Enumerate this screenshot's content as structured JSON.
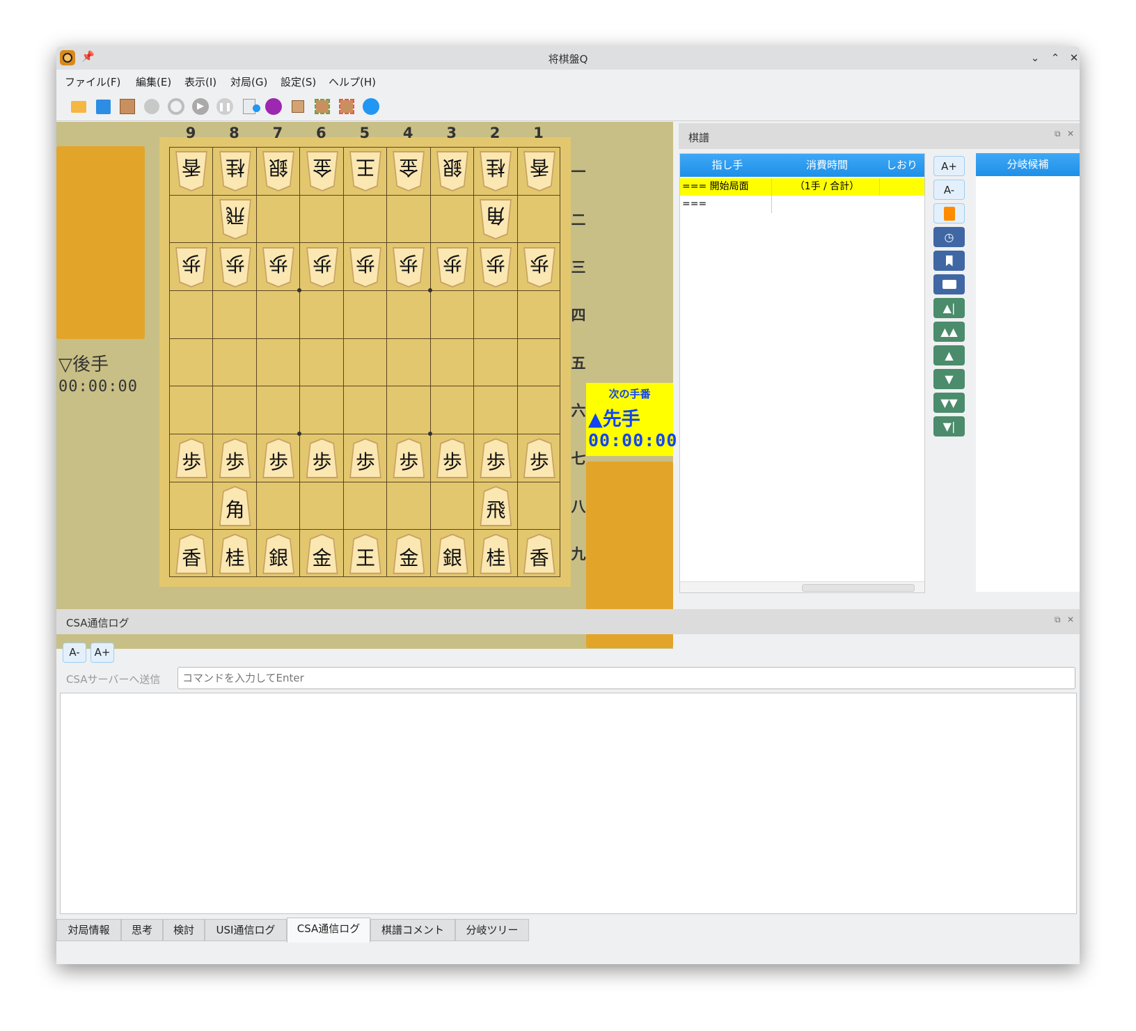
{
  "window": {
    "title": "将棋盤Q"
  },
  "menu": [
    "ファイル(F)",
    "編集(E)",
    "表示(I)",
    "対局(G)",
    "設定(S)",
    "ヘルプ(H)"
  ],
  "toolbar_icons": [
    "open-file-icon",
    "save-icon",
    "board-icon",
    "resign-icon",
    "stop-icon",
    "play-icon",
    "pause-icon",
    "kifu-time-icon",
    "engine-icon",
    "resize-board-icon",
    "enlarge-board-icon",
    "shrink-board-icon",
    "flip-board-icon"
  ],
  "board": {
    "files": [
      "9",
      "8",
      "7",
      "6",
      "5",
      "4",
      "3",
      "2",
      "1"
    ],
    "ranks": [
      "一",
      "二",
      "三",
      "四",
      "五",
      "六",
      "七",
      "八",
      "九"
    ],
    "rows": [
      [
        [
          "香",
          "g"
        ],
        [
          "桂",
          "g"
        ],
        [
          "銀",
          "g"
        ],
        [
          "金",
          "g"
        ],
        [
          "王",
          "g"
        ],
        [
          "金",
          "g"
        ],
        [
          "銀",
          "g"
        ],
        [
          "桂",
          "g"
        ],
        [
          "香",
          "g"
        ]
      ],
      [
        null,
        [
          "飛",
          "g"
        ],
        null,
        null,
        null,
        null,
        null,
        [
          "角",
          "g"
        ],
        null
      ],
      [
        [
          "歩",
          "g"
        ],
        [
          "歩",
          "g"
        ],
        [
          "歩",
          "g"
        ],
        [
          "歩",
          "g"
        ],
        [
          "歩",
          "g"
        ],
        [
          "歩",
          "g"
        ],
        [
          "歩",
          "g"
        ],
        [
          "歩",
          "g"
        ],
        [
          "歩",
          "g"
        ]
      ],
      [
        null,
        null,
        null,
        null,
        null,
        null,
        null,
        null,
        null
      ],
      [
        null,
        null,
        null,
        null,
        null,
        null,
        null,
        null,
        null
      ],
      [
        null,
        null,
        null,
        null,
        null,
        null,
        null,
        null,
        null
      ],
      [
        [
          "歩",
          "s"
        ],
        [
          "歩",
          "s"
        ],
        [
          "歩",
          "s"
        ],
        [
          "歩",
          "s"
        ],
        [
          "歩",
          "s"
        ],
        [
          "歩",
          "s"
        ],
        [
          "歩",
          "s"
        ],
        [
          "歩",
          "s"
        ],
        [
          "歩",
          "s"
        ]
      ],
      [
        null,
        [
          "角",
          "s"
        ],
        null,
        null,
        null,
        null,
        null,
        [
          "飛",
          "s"
        ],
        null
      ],
      [
        [
          "香",
          "s"
        ],
        [
          "桂",
          "s"
        ],
        [
          "銀",
          "s"
        ],
        [
          "金",
          "s"
        ],
        [
          "王",
          "s"
        ],
        [
          "金",
          "s"
        ],
        [
          "銀",
          "s"
        ],
        [
          "桂",
          "s"
        ],
        [
          "香",
          "s"
        ]
      ]
    ]
  },
  "gote": {
    "label": "▽後手",
    "time": "00:00:00"
  },
  "turn": {
    "caption": "次の手番",
    "player": "▲先手",
    "time": "00:00:00"
  },
  "kifu": {
    "title": "棋譜",
    "columns": [
      "指し手",
      "消費時間",
      "しおり"
    ],
    "rows": [
      {
        "move": "=== 開始局面 ===",
        "time": "（1手 / 合計）",
        "bookmark": ""
      }
    ],
    "font_up": "A+",
    "font_down": "A-",
    "branch_header": "分岐候補"
  },
  "csa": {
    "title": "CSA通信ログ",
    "font_down": "A-",
    "font_up": "A+",
    "send_label": "CSAサーバーへ送信",
    "input_placeholder": "コマンドを入力してEnter",
    "input_value": ""
  },
  "tabs": [
    "対局情報",
    "思考",
    "検討",
    "USI通信ログ",
    "CSA通信ログ",
    "棋譜コメント",
    "分岐ツリー"
  ],
  "active_tab": "CSA通信ログ"
}
